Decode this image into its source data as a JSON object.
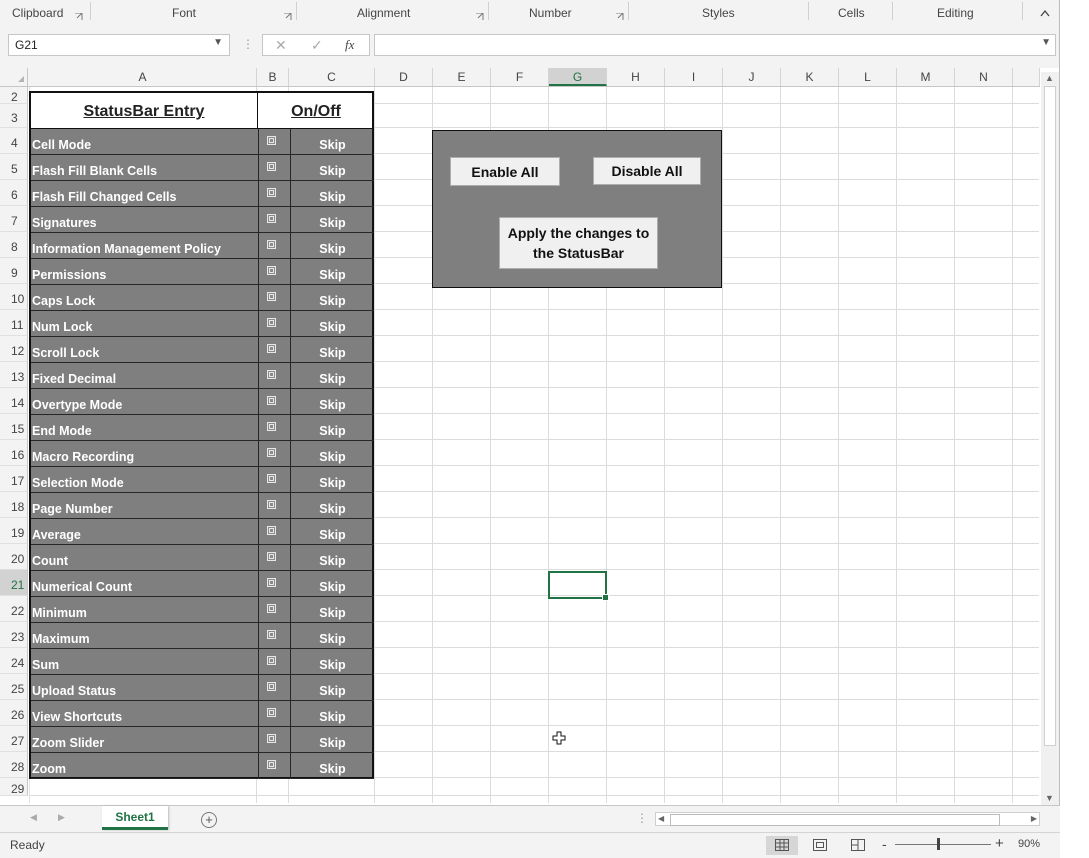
{
  "ribbon": {
    "groups": [
      "Clipboard",
      "Font",
      "Alignment",
      "Number",
      "Styles",
      "Cells",
      "Editing"
    ]
  },
  "formula_bar": {
    "name_box": "G21",
    "cancel_icon": "✕",
    "enter_icon": "✓",
    "fx_label": "fx",
    "formula": ""
  },
  "columns": [
    "A",
    "B",
    "C",
    "D",
    "E",
    "F",
    "G",
    "H",
    "I",
    "J",
    "K",
    "L",
    "M",
    "N"
  ],
  "selected_column": "G",
  "rows": [
    "2",
    "3",
    "4",
    "5",
    "6",
    "7",
    "8",
    "9",
    "10",
    "11",
    "12",
    "13",
    "14",
    "15",
    "16",
    "17",
    "18",
    "19",
    "20",
    "21",
    "22",
    "23",
    "24",
    "25",
    "26",
    "27",
    "28",
    "29"
  ],
  "selected_row": "21",
  "table": {
    "header_entry": "StatusBar Entry",
    "header_onoff": "On/Off",
    "entries": [
      {
        "name": "Cell Mode",
        "value": "Skip"
      },
      {
        "name": "Flash Fill Blank Cells",
        "value": "Skip"
      },
      {
        "name": "Flash Fill Changed Cells",
        "value": "Skip"
      },
      {
        "name": "Signatures",
        "value": "Skip"
      },
      {
        "name": "Information Management Policy",
        "value": "Skip"
      },
      {
        "name": "Permissions",
        "value": "Skip"
      },
      {
        "name": "Caps Lock",
        "value": "Skip"
      },
      {
        "name": "Num Lock",
        "value": "Skip"
      },
      {
        "name": "Scroll Lock",
        "value": "Skip"
      },
      {
        "name": "Fixed Decimal",
        "value": "Skip"
      },
      {
        "name": "Overtype Mode",
        "value": "Skip"
      },
      {
        "name": "End Mode",
        "value": "Skip"
      },
      {
        "name": "Macro Recording",
        "value": "Skip"
      },
      {
        "name": "Selection Mode",
        "value": "Skip"
      },
      {
        "name": "Page Number",
        "value": "Skip"
      },
      {
        "name": "Average",
        "value": "Skip"
      },
      {
        "name": "Count",
        "value": "Skip"
      },
      {
        "name": "Numerical Count",
        "value": "Skip"
      },
      {
        "name": "Minimum",
        "value": "Skip"
      },
      {
        "name": "Maximum",
        "value": "Skip"
      },
      {
        "name": "Sum",
        "value": "Skip"
      },
      {
        "name": "Upload Status",
        "value": "Skip"
      },
      {
        "name": "View Shortcuts",
        "value": "Skip"
      },
      {
        "name": "Zoom Slider",
        "value": "Skip"
      },
      {
        "name": "Zoom",
        "value": "Skip"
      }
    ]
  },
  "panel": {
    "enable_all": "Enable All",
    "disable_all": "Disable All",
    "apply_line1": "Apply the changes to",
    "apply_line2": "the StatusBar"
  },
  "sheet_tabs": {
    "active": "Sheet1",
    "add_icon": "+"
  },
  "status_bar": {
    "ready": "Ready",
    "zoom_minus": "-",
    "zoom_plus": "+",
    "zoom": "90%"
  },
  "colors": {
    "accent": "#217346",
    "table_fill": "#7f7f7f"
  }
}
